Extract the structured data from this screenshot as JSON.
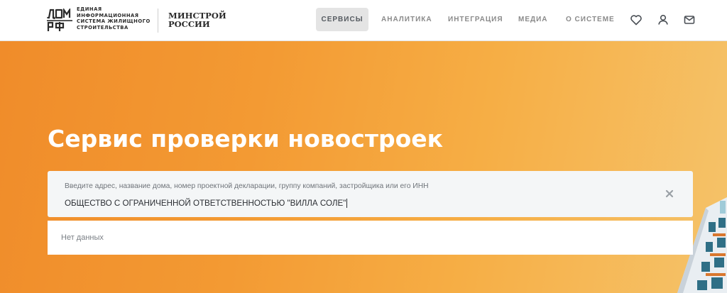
{
  "header": {
    "logo_lines": [
      "ЕДИНАЯ",
      "ИНФОРМАЦИОННАЯ",
      "СИСТЕМА ЖИЛИЩНОГО",
      "СТРОИТЕЛЬСТВА"
    ],
    "ministry_lines": [
      "МИНСТРОЙ",
      "РОССИИ"
    ],
    "nav": [
      "СЕРВИСЫ",
      "АНАЛИТИКА",
      "ИНТЕГРАЦИЯ",
      "МЕДИА",
      "О СИСТЕМЕ"
    ],
    "active_nav": "СЕРВИСЫ",
    "icons": [
      "heart-icon",
      "user-icon",
      "mail-icon"
    ]
  },
  "hero": {
    "title": "Сервис проверки новостроек"
  },
  "search": {
    "label": "Введите адрес, название дома, номер проектной декларации, группу компаний, застройщика или его ИНН",
    "value": "ОБЩЕСТВО С ОГРАНИЧЕННОЙ ОТВЕТСТВЕННОСТЬЮ \"ВИЛЛА СОЛЕ\"",
    "clear_icon": "close-icon"
  },
  "results": {
    "empty_text": "Нет данных"
  },
  "colors": {
    "accent_orange": "#f39a33",
    "active_nav_bg": "#e4e4e4",
    "text_dark": "#2b2e33"
  }
}
